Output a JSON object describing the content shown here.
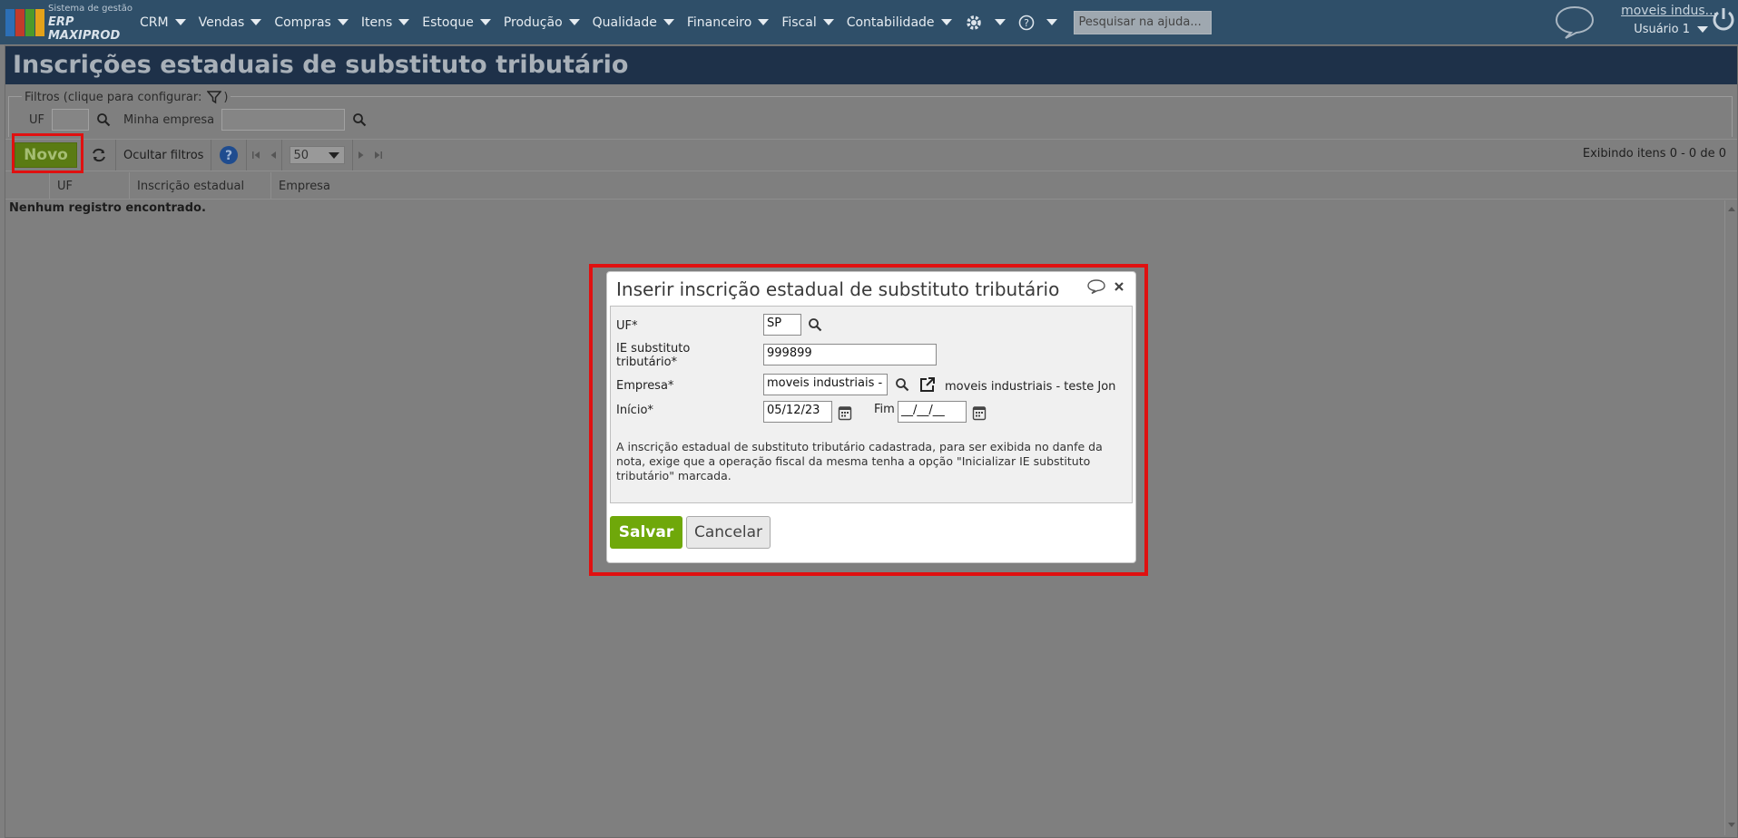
{
  "app": {
    "logo_line1": "Sistema de gestão",
    "logo_line2": "ERP MAXIPROD",
    "logo_colors": [
      "#2c6fb6",
      "#c23a2b",
      "#4c9a2a",
      "#e3a21a"
    ]
  },
  "nav": {
    "items": [
      {
        "label": "CRM"
      },
      {
        "label": "Vendas"
      },
      {
        "label": "Compras"
      },
      {
        "label": "Itens"
      },
      {
        "label": "Estoque"
      },
      {
        "label": "Produção"
      },
      {
        "label": "Qualidade"
      },
      {
        "label": "Financeiro"
      },
      {
        "label": "Fiscal"
      },
      {
        "label": "Contabilidade"
      }
    ],
    "settings_icon": "gear-icon",
    "help_icon": "help-circle-icon",
    "search_placeholder": "Pesquisar na ajuda..."
  },
  "user": {
    "company": "moveis indus...",
    "name": "Usuário 1"
  },
  "page": {
    "title": "Inscrições estaduais de substituto tributário"
  },
  "filters": {
    "legend": "Filtros (clique para configurar:",
    "legend_end": ")",
    "uf_label": "UF",
    "company_label": "Minha empresa"
  },
  "toolbar": {
    "new_label": "Novo",
    "hide_filters_label": "Ocultar filtros",
    "page_size": "50",
    "showing": "Exibindo itens 0 - 0 de 0"
  },
  "grid": {
    "columns": [
      "UF",
      "Inscrição estadual",
      "Empresa"
    ],
    "empty_message": "Nenhum registro encontrado."
  },
  "dialog": {
    "title": "Inserir inscrição estadual de substituto tributário",
    "uf_label": "UF*",
    "uf_value": "SP",
    "ie_label_line1": "IE substituto",
    "ie_label_line2": "tributário*",
    "ie_value": "999899",
    "company_label": "Empresa*",
    "company_value": "moveis industriais -",
    "company_display": "moveis industriais - teste Jon",
    "start_label": "Início*",
    "start_value": "05/12/23",
    "end_label": "Fim",
    "end_value": "__/__/__",
    "note": "A inscrição estadual de substituto tributário cadastrada, para ser exibida no danfe da nota, exige que a operação fiscal da mesma tenha a opção \"Inicializar IE substituto tributário\" marcada.",
    "save_label": "Salvar",
    "cancel_label": "Cancelar"
  },
  "colors": {
    "topbar": "#2f4f69",
    "title_bar": "#1e3149",
    "overlay": "#7f7f7f",
    "save_button": "#6fa80a",
    "highlight": "#e01010"
  }
}
